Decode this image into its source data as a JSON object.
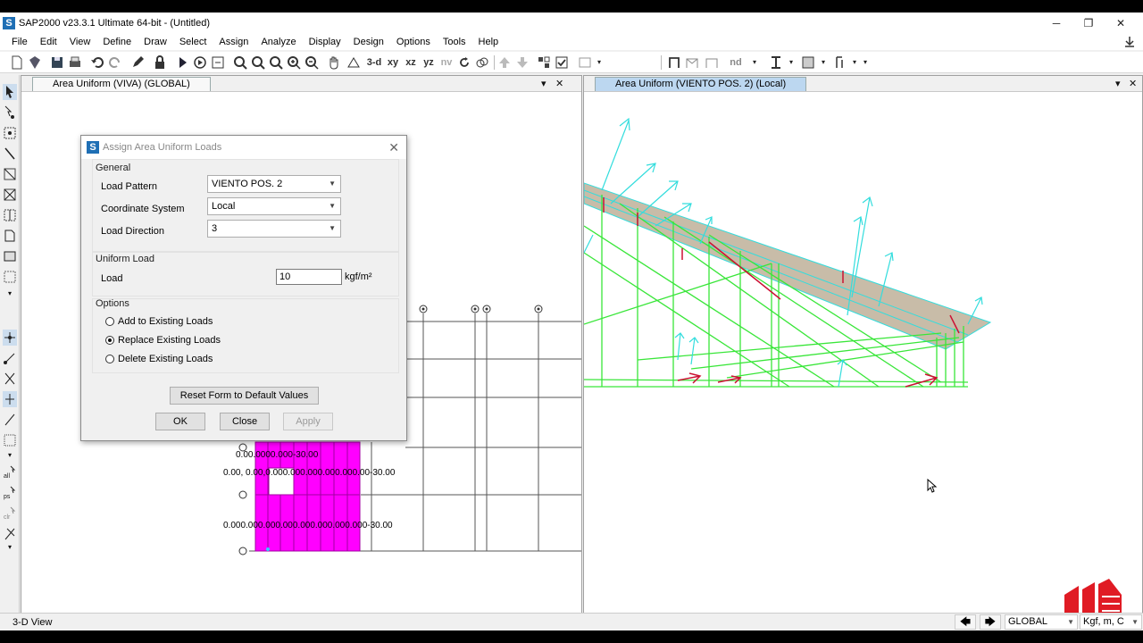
{
  "window": {
    "title": "SAP2000 v23.3.1 Ultimate 64-bit - (Untitled)",
    "controls": [
      "─",
      "❐",
      "✕"
    ]
  },
  "menu": [
    "File",
    "Edit",
    "View",
    "Define",
    "Draw",
    "Select",
    "Assign",
    "Analyze",
    "Display",
    "Design",
    "Options",
    "Tools",
    "Help"
  ],
  "toolbar": {
    "view_3d": "3-d",
    "view_xy": "xy",
    "view_xz": "xz",
    "view_yz": "yz",
    "view_nv": "nv",
    "nd": "nd"
  },
  "panes": {
    "left": {
      "title": "Area Uniform (VIVA) (GLOBAL)"
    },
    "right": {
      "title": "Area Uniform (VIENTO POS. 2) (Local)"
    },
    "controls": {
      "dropdown": "▾",
      "close": "✕"
    }
  },
  "model_labels": {
    "row1": "0.00.0000.000-30.00",
    "row2_a": "0.00, 0.00,0.000.000.000.000.000.00-30.00",
    "row3": "0.000.000.000.000.000.000.000.000-30.00"
  },
  "dialog": {
    "title": "Assign Area Uniform Loads",
    "close": "✕",
    "general": {
      "label": "General",
      "load_pattern_label": "Load Pattern",
      "load_pattern_value": "VIENTO POS. 2",
      "coordinate_system_label": "Coordinate System",
      "coordinate_system_value": "Local",
      "load_direction_label": "Load Direction",
      "load_direction_value": "3"
    },
    "uniform_load": {
      "label": "Uniform Load",
      "load_label": "Load",
      "load_value": "10",
      "unit": "kgf/m²"
    },
    "options": {
      "label": "Options",
      "items": [
        {
          "label": "Add to Existing Loads",
          "selected": false
        },
        {
          "label": "Replace Existing Loads",
          "selected": true
        },
        {
          "label": "Delete Existing Loads",
          "selected": false
        }
      ]
    },
    "buttons": {
      "reset": "Reset Form to Default Values",
      "ok": "OK",
      "close": "Close",
      "apply": "Apply"
    }
  },
  "status": {
    "view": "3-D View",
    "coord_system": "GLOBAL",
    "units": "Kgf, m, C"
  },
  "colors": {
    "accent": "#1f6fb5",
    "area_fill": "#ff00ff",
    "frame_green": "#39e639",
    "load_cyan": "#33dddd",
    "load_red": "#cc1133",
    "roof": "#c8bca8"
  }
}
